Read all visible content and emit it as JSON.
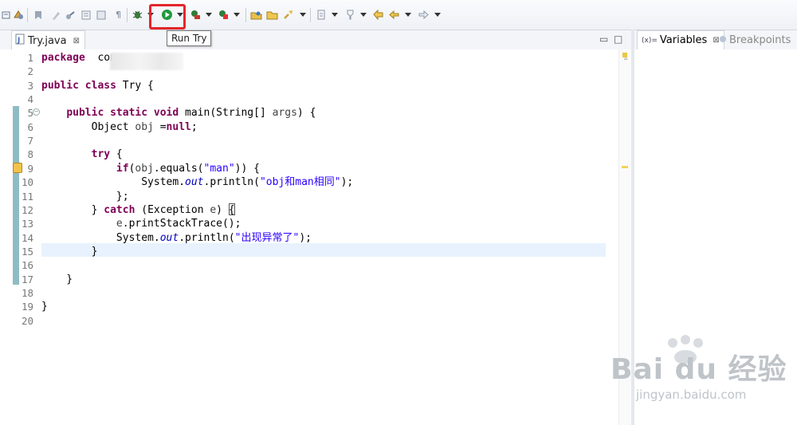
{
  "toolbar": {
    "run_tooltip": "Run Try",
    "run_icon_color": "#1e9a3c",
    "highlight_color": "#e3262b"
  },
  "editor": {
    "tab_label": "Try.java",
    "tab_close": "⊠",
    "minimize": "▭",
    "maximize": "□",
    "line_numbers": [
      "1",
      "2",
      "3",
      "4",
      "5",
      "6",
      "7",
      "8",
      "9",
      "10",
      "11",
      "12",
      "13",
      "14",
      "15",
      "16",
      "17",
      "18",
      "19",
      "20"
    ],
    "lines": [
      {
        "t": [
          [
            "kw",
            "package"
          ],
          [
            "",
            "  com"
          ]
        ]
      },
      {
        "t": []
      },
      {
        "t": [
          [
            "kw",
            "public class"
          ],
          [
            "",
            " Try {"
          ]
        ]
      },
      {
        "t": []
      },
      {
        "t": [
          [
            "",
            "    "
          ],
          [
            "kw",
            "public static void"
          ],
          [
            "",
            " main(String[] "
          ],
          [
            "dim",
            "args"
          ],
          [
            "",
            ") {"
          ]
        ]
      },
      {
        "t": [
          [
            "",
            "        Object "
          ],
          [
            "dim",
            "obj"
          ],
          [
            "",
            " ="
          ],
          [
            "kw",
            "null"
          ],
          [
            "",
            ";"
          ]
        ]
      },
      {
        "t": []
      },
      {
        "t": [
          [
            "",
            "        "
          ],
          [
            "kw",
            "try"
          ],
          [
            "",
            " {"
          ]
        ]
      },
      {
        "t": [
          [
            "",
            "            "
          ],
          [
            "kw",
            "if"
          ],
          [
            "",
            "("
          ],
          [
            "dim",
            "obj"
          ],
          [
            "",
            ".equals("
          ],
          [
            "str",
            "\"man\""
          ],
          [
            "",
            ")) {"
          ]
        ]
      },
      {
        "t": [
          [
            "",
            "                System."
          ],
          [
            "fld",
            "out"
          ],
          [
            "",
            ".println("
          ],
          [
            "str",
            "\"obj和man相同\""
          ],
          [
            "",
            ");"
          ]
        ]
      },
      {
        "t": [
          [
            "",
            "            };"
          ]
        ]
      },
      {
        "t": [
          [
            "",
            "        } "
          ],
          [
            "kw",
            "catch"
          ],
          [
            "",
            " (Exception "
          ],
          [
            "dim",
            "e"
          ],
          [
            "",
            ") {"
          ]
        ]
      },
      {
        "t": [
          [
            "",
            "            "
          ],
          [
            "dim",
            "e"
          ],
          [
            "",
            ".printStackTrace();"
          ]
        ]
      },
      {
        "t": [
          [
            "",
            "            System."
          ],
          [
            "fld",
            "out"
          ],
          [
            "",
            ".println("
          ],
          [
            "str",
            "\"出现异常了\""
          ],
          [
            "",
            ");"
          ]
        ]
      },
      {
        "t": [
          [
            "",
            "        }"
          ]
        ]
      },
      {
        "t": []
      },
      {
        "t": [
          [
            "",
            "    }"
          ]
        ]
      },
      {
        "t": []
      },
      {
        "t": [
          [
            "",
            "}"
          ]
        ]
      },
      {
        "t": []
      }
    ]
  },
  "right_panel": {
    "variables_tab": "Variables",
    "variables_close": "⊠",
    "breakpoints_tab": "Breakpoints"
  },
  "watermark": {
    "logo": "Bai du 经验",
    "url": "jingyan.baidu.com"
  }
}
